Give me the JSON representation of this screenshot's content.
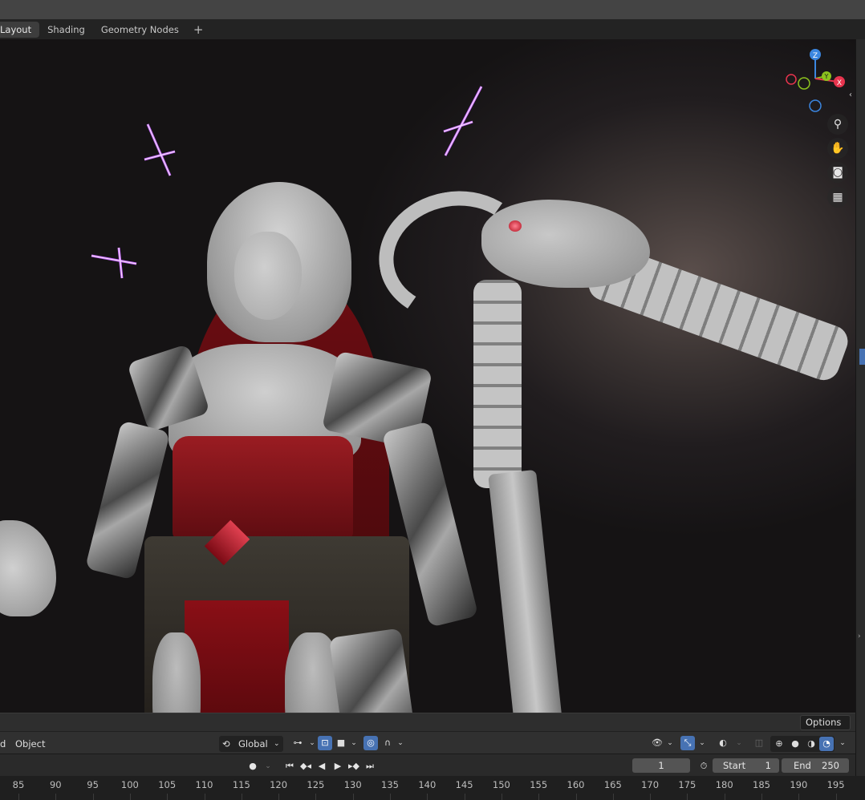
{
  "workspace_tabs": [
    "Layout",
    "Shading",
    "Geometry Nodes"
  ],
  "add_tab_label": "+",
  "gizmo": {
    "z": "Z",
    "y": "Y",
    "x": "X"
  },
  "nav_icons": [
    "zoom-icon",
    "hand-pan-icon",
    "camera-icon",
    "grid-perspective-icon"
  ],
  "options_label": "Options",
  "header": {
    "left_text": "d",
    "mode": "Object",
    "transform_orientation": "Global"
  },
  "timeline": {
    "current_frame": "1",
    "start_label": "Start",
    "start_value": "1",
    "end_label": "End",
    "end_value": "250"
  },
  "ruler_ticks": [
    "85",
    "90",
    "95",
    "100",
    "105",
    "110",
    "115",
    "120",
    "125",
    "130",
    "135",
    "140",
    "145",
    "150",
    "155",
    "160",
    "165",
    "170",
    "175",
    "180",
    "185",
    "190",
    "195"
  ],
  "colors": {
    "accent": "#4772b3",
    "axis_x": "#e8344e",
    "axis_y": "#8cc21e",
    "axis_z": "#3b86e0",
    "star_glow": "#b14cff"
  }
}
